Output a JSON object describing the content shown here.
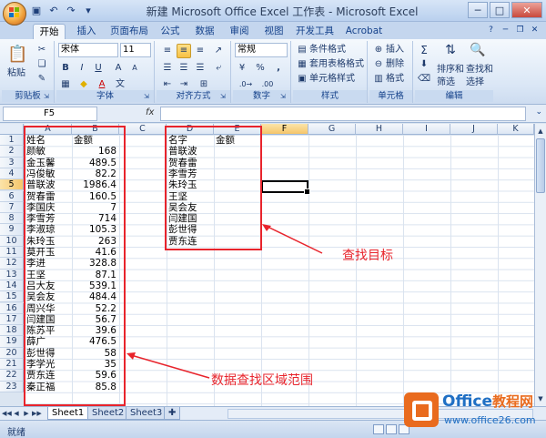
{
  "window": {
    "title": "新建 Microsoft Office Excel 工作表 - Microsoft Excel",
    "minimize_icon": "minimize-icon",
    "maximize_icon": "maximize-icon",
    "close_icon": "close-icon"
  },
  "ribbon_tabs": [
    "开始",
    "插入",
    "页面布局",
    "公式",
    "数据",
    "审阅",
    "视图",
    "开发工具",
    "Acrobat"
  ],
  "active_tab": "开始",
  "ribbon": {
    "clipboard": {
      "paste_label": "粘贴",
      "group_label": "剪贴板"
    },
    "font": {
      "font_name": "宋体",
      "font_size": "11",
      "bold": "B",
      "italic": "I",
      "underline": "U",
      "grow": "A",
      "shrink": "A",
      "font_color": "A",
      "group_label": "字体"
    },
    "alignment": {
      "group_label": "对齐方式"
    },
    "number": {
      "format": "常规",
      "percent": "%",
      "comma": ",",
      "group_label": "数字"
    },
    "styles": {
      "conditional": "条件格式",
      "table": "套用表格格式",
      "cell_styles": "单元格样式",
      "group_label": "样式"
    },
    "cells": {
      "insert": "插入",
      "delete": "删除",
      "format": "格式",
      "group_label": "单元格"
    },
    "editing": {
      "sum": "Σ",
      "sort_filter": "排序和",
      "sort_filter2": "筛选",
      "find_select": "查找和",
      "find_select2": "选择",
      "group_label": "编辑"
    }
  },
  "formula_bar": {
    "name_box": "F5",
    "fx": "fx",
    "value": ""
  },
  "columns": [
    "A",
    "B",
    "C",
    "D",
    "E",
    "F",
    "G",
    "H",
    "I",
    "J",
    "K"
  ],
  "selected_column": "F",
  "rows": [
    "1",
    "2",
    "3",
    "4",
    "5",
    "6",
    "7",
    "8",
    "9",
    "10",
    "11",
    "12",
    "13",
    "14",
    "15",
    "16",
    "17",
    "18",
    "19",
    "20",
    "21",
    "22",
    "23"
  ],
  "selected_row": "5",
  "col_a": [
    "姓名",
    "颜敏",
    "金玉馨",
    "冯俊敏",
    "普联波",
    "贺春雷",
    "李国庆",
    "李雪芳",
    "李淑琼",
    "朱玲玉",
    "莫开玉",
    "李进",
    "王坚",
    "吕大友",
    "吴会友",
    "周兴华",
    "闫建国",
    "陈苏平",
    "薛广",
    "彭世得",
    "李学光",
    "贾东连",
    "秦正福"
  ],
  "col_b_header": "金额",
  "col_b": [
    "168",
    "489.5",
    "82.2",
    "1986.4",
    "160.5",
    "7",
    "714",
    "105.3",
    "263",
    "41.6",
    "328.8",
    "87.1",
    "539.1",
    "484.4",
    "52.2",
    "56.7",
    "39.6",
    "476.5",
    "58",
    "35",
    "59.6",
    "85.8"
  ],
  "col_d": [
    "名字",
    "普联波",
    "贺春雷",
    "李雪芳",
    "朱玲玉",
    "王坚",
    "吴会友",
    "闫建国",
    "彭世得",
    "贾东连"
  ],
  "col_e_header": "金额",
  "annotations": {
    "lookup_target": "查找目标",
    "lookup_range": "数据查找区域范围"
  },
  "sheet_tabs": [
    "Sheet1",
    "Sheet2",
    "Sheet3"
  ],
  "active_sheet": "Sheet1",
  "status": {
    "ready": "就绪"
  },
  "watermark": {
    "brand": "Office",
    "brand_cn": "教程网",
    "url": "www.office26.com"
  },
  "colors": {
    "accent_red": "#e8242c",
    "ribbon_blue": "#15428b"
  }
}
